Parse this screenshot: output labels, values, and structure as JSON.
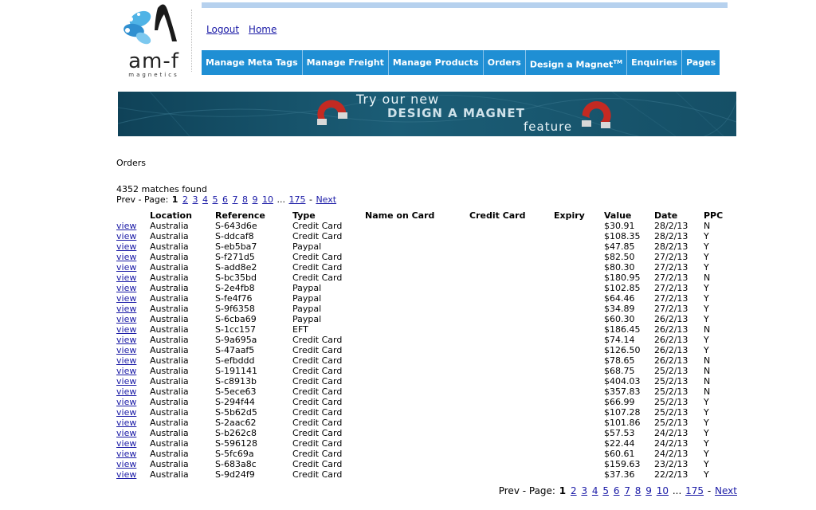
{
  "logo": {
    "word": "am-f",
    "sub": "magnetics"
  },
  "toplinks": [
    {
      "label": "Logout"
    },
    {
      "label": "Home"
    }
  ],
  "nav": [
    {
      "label": "Manage Meta Tags"
    },
    {
      "label": "Manage Freight"
    },
    {
      "label": "Manage Products"
    },
    {
      "label": "Orders"
    },
    {
      "label": "Design a Magnet",
      "sup": "TM"
    },
    {
      "label": "Enquiries"
    },
    {
      "label": "Pages"
    }
  ],
  "banner": {
    "line1": "Try our new",
    "line2": "DESIGN A MAGNET",
    "line3": "feature"
  },
  "heading": "Orders",
  "matches": "4352 matches found",
  "pager": {
    "prev": "Prev - Page:",
    "current": "1",
    "pages": [
      "2",
      "3",
      "4",
      "5",
      "6",
      "7",
      "8",
      "9",
      "10"
    ],
    "ellipsis": "...",
    "last": "175",
    "sep": "-",
    "next": "Next"
  },
  "columns": [
    "",
    "Location",
    "Reference",
    "Type",
    "Name on Card",
    "Credit Card",
    "Expiry",
    "Value",
    "Date",
    "PPC"
  ],
  "view_label": "view",
  "rows": [
    [
      "Australia",
      "S-643d6e",
      "Credit Card",
      "",
      "",
      "",
      "$30.91",
      "28/2/13",
      "N"
    ],
    [
      "Australia",
      "S-ddcaf8",
      "Credit Card",
      "",
      "",
      "",
      "$108.35",
      "28/2/13",
      "Y"
    ],
    [
      "Australia",
      "S-eb5ba7",
      "Paypal",
      "",
      "",
      "",
      "$47.85",
      "28/2/13",
      "Y"
    ],
    [
      "Australia",
      "S-f271d5",
      "Credit Card",
      "",
      "",
      "",
      "$82.50",
      "27/2/13",
      "Y"
    ],
    [
      "Australia",
      "S-add8e2",
      "Credit Card",
      "",
      "",
      "",
      "$80.30",
      "27/2/13",
      "Y"
    ],
    [
      "Australia",
      "S-bc35bd",
      "Credit Card",
      "",
      "",
      "",
      "$180.95",
      "27/2/13",
      "N"
    ],
    [
      "Australia",
      "S-2e4fb8",
      "Paypal",
      "",
      "",
      "",
      "$102.85",
      "27/2/13",
      "Y"
    ],
    [
      "Australia",
      "S-fe4f76",
      "Paypal",
      "",
      "",
      "",
      "$64.46",
      "27/2/13",
      "Y"
    ],
    [
      "Australia",
      "S-9f6358",
      "Paypal",
      "",
      "",
      "",
      "$34.89",
      "27/2/13",
      "Y"
    ],
    [
      "Australia",
      "S-6cba69",
      "Paypal",
      "",
      "",
      "",
      "$60.30",
      "26/2/13",
      "Y"
    ],
    [
      "Australia",
      "S-1cc157",
      "EFT",
      "",
      "",
      "",
      "$186.45",
      "26/2/13",
      "N"
    ],
    [
      "Australia",
      "S-9a695a",
      "Credit Card",
      "",
      "",
      "",
      "$74.14",
      "26/2/13",
      "Y"
    ],
    [
      "Australia",
      "S-47aaf5",
      "Credit Card",
      "",
      "",
      "",
      "$126.50",
      "26/2/13",
      "Y"
    ],
    [
      "Australia",
      "S-efbddd",
      "Credit Card",
      "",
      "",
      "",
      "$78.65",
      "26/2/13",
      "N"
    ],
    [
      "Australia",
      "S-191141",
      "Credit Card",
      "",
      "",
      "",
      "$68.75",
      "25/2/13",
      "N"
    ],
    [
      "Australia",
      "S-c8913b",
      "Credit Card",
      "",
      "",
      "",
      "$404.03",
      "25/2/13",
      "N"
    ],
    [
      "Australia",
      "S-5ece63",
      "Credit Card",
      "",
      "",
      "",
      "$357.83",
      "25/2/13",
      "N"
    ],
    [
      "Australia",
      "S-294f44",
      "Credit Card",
      "",
      "",
      "",
      "$66.99",
      "25/2/13",
      "Y"
    ],
    [
      "Australia",
      "S-5b62d5",
      "Credit Card",
      "",
      "",
      "",
      "$107.28",
      "25/2/13",
      "Y"
    ],
    [
      "Australia",
      "S-2aac62",
      "Credit Card",
      "",
      "",
      "",
      "$101.86",
      "25/2/13",
      "Y"
    ],
    [
      "Australia",
      "S-b262c8",
      "Credit Card",
      "",
      "",
      "",
      "$57.53",
      "24/2/13",
      "Y"
    ],
    [
      "Australia",
      "S-596128",
      "Credit Card",
      "",
      "",
      "",
      "$22.44",
      "24/2/13",
      "Y"
    ],
    [
      "Australia",
      "S-5fc69a",
      "Credit Card",
      "",
      "",
      "",
      "$60.61",
      "24/2/13",
      "Y"
    ],
    [
      "Australia",
      "S-683a8c",
      "Credit Card",
      "",
      "",
      "",
      "$159.63",
      "23/2/13",
      "Y"
    ],
    [
      "Australia",
      "S-9d24f9",
      "Credit Card",
      "",
      "",
      "",
      "$37.36",
      "22/2/13",
      "Y"
    ]
  ]
}
